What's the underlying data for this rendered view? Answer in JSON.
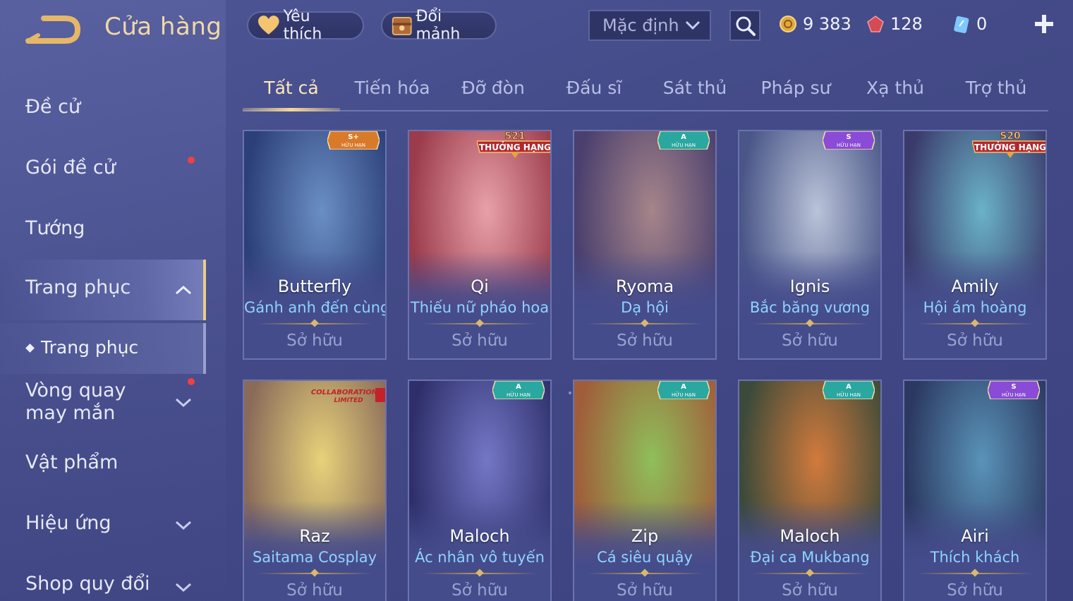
{
  "header": {
    "title": "Cửa hàng",
    "favorites_label": "Yêu thích",
    "shards_label": "Đổi mảnh",
    "sort_selected": "Mặc định",
    "currencies": {
      "gold": "9 383",
      "ruby": "128",
      "voucher": "0"
    }
  },
  "sidebar": {
    "items": [
      {
        "label": "Đề cử"
      },
      {
        "label": "Gói đề cử"
      },
      {
        "label": "Tướng"
      },
      {
        "label": "Trang phục"
      },
      {
        "label": "Vòng quay may mắn"
      },
      {
        "label": "Vật phẩm"
      },
      {
        "label": "Hiệu ứng"
      },
      {
        "label": "Shop quy đổi"
      }
    ],
    "sub_items": [
      {
        "label": "Trang phục"
      }
    ]
  },
  "tabs": [
    {
      "label": "Tất cả"
    },
    {
      "label": "Tiến hóa"
    },
    {
      "label": "Đỡ đòn"
    },
    {
      "label": "Đấu sĩ"
    },
    {
      "label": "Sát thủ"
    },
    {
      "label": "Pháp sư"
    },
    {
      "label": "Xạ thủ"
    },
    {
      "label": "Trợ thủ"
    }
  ],
  "badges": {
    "limited": "HỮU HẠN",
    "rank_reward": "THƯỞNG HẠNG",
    "collab_line1": "COLLABORATION",
    "collab_line2": "LIMITED"
  },
  "cards": [
    {
      "hero": "Butterfly",
      "skin": "Gánh anh đến cùng",
      "status": "Sở hữu",
      "tier": "S+",
      "badge": "tier",
      "art": "#6a8fc4",
      "art2": "#2c3f78"
    },
    {
      "hero": "Qi",
      "skin": "Thiếu nữ pháo hoa",
      "status": "Sở hữu",
      "tier": "S21",
      "badge": "rank",
      "art": "#e8a1a8",
      "art2": "#9b3b4b"
    },
    {
      "hero": "Ryoma",
      "skin": "Dạ hội",
      "status": "Sở hữu",
      "tier": "A",
      "badge": "tier",
      "art": "#a6858a",
      "art2": "#4a3f6e"
    },
    {
      "hero": "Ignis",
      "skin": "Bắc băng vương",
      "status": "Sở hữu",
      "tier": "S",
      "badge": "tier",
      "art": "#b9c3d8",
      "art2": "#4a5688"
    },
    {
      "hero": "Amily",
      "skin": "Hội ám hoàng",
      "status": "Sở hữu",
      "tier": "S20",
      "badge": "rank",
      "art": "#6ab2c8",
      "art2": "#3a3b6a"
    },
    {
      "hero": "Raz",
      "skin": "Saitama Cosplay",
      "status": "Sở hữu",
      "tier": "",
      "badge": "collab",
      "art": "#e7d27a",
      "art2": "#8a6b5a"
    },
    {
      "hero": "Maloch",
      "skin": "Ác nhân vô tuyến",
      "status": "Sở hữu",
      "tier": "A",
      "badge": "tier",
      "art": "#7477c6",
      "art2": "#2e2f6a"
    },
    {
      "hero": "Zip",
      "skin": "Cá siêu quậy",
      "status": "Sở hữu",
      "tier": "A",
      "badge": "tier",
      "art": "#8fbf5a",
      "art2": "#a05d3a"
    },
    {
      "hero": "Maloch",
      "skin": "Đại ca Mukbang",
      "status": "Sở hữu",
      "tier": "A",
      "badge": "tier",
      "art": "#d27a3c",
      "art2": "#3b4a3a"
    },
    {
      "hero": "Airi",
      "skin": "Thích khách",
      "status": "Sở hữu",
      "tier": "S",
      "badge": "tier",
      "art": "#5a93b8",
      "art2": "#2b3860"
    }
  ],
  "colors": {
    "accent_gold": "#f1d9a4",
    "skin_name": "#8fd3ff",
    "notification": "#f0413f",
    "tier_a": "#2aa7a0",
    "tier_s": "#8a4bd6",
    "tier_splus": "#d97a2a"
  }
}
